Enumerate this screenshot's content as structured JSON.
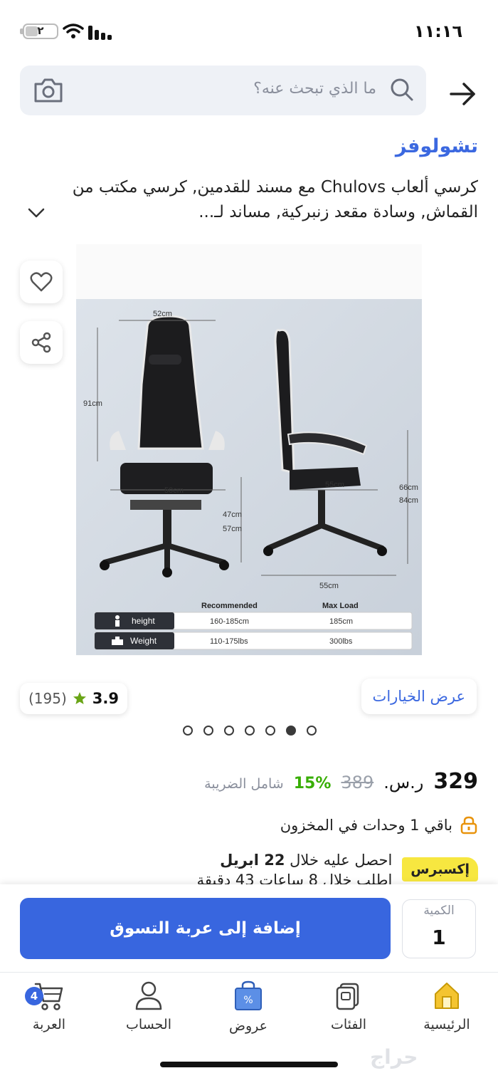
{
  "status_bar": {
    "time": "١١:١٦",
    "battery_level": "٢",
    "battery_percent": 0.4
  },
  "search": {
    "placeholder": "ما الذي تبحث عنه؟"
  },
  "product": {
    "brand": "تشولوفز",
    "title": "كرسي ألعاب Chulovs مع مسند للقدمين, كرسي مكتب من القماش, وسادة مقعد زنبركية, مساند لـ...",
    "image_text": {
      "width_label": "52cm",
      "height_label": "91cm",
      "seat_width_label": "50cm",
      "seat_height_top": "47cm",
      "seat_height_bottom": "57cm",
      "side_depth_label": "55cm",
      "total_height_top": "66cm",
      "total_height_bottom": "84cm",
      "base_label": "55cm",
      "table_header_recommended": "Recommended",
      "table_header_max": "Max Load",
      "row1_label": "height",
      "row1_recommended": "160-185cm",
      "row1_max": "185cm",
      "row2_label": "Weight",
      "row2_recommended": "110-175lbs",
      "row2_max": "300lbs"
    },
    "options_label": "عرض الخيارات",
    "rating": {
      "value": "3.9",
      "count": "(195)"
    },
    "gallery": {
      "total": 7,
      "active_index": 5
    }
  },
  "pricing": {
    "price": "329",
    "currency": "ر.س.",
    "old_price": "389",
    "discount": "15%",
    "vat_note": "شامل الضريبة"
  },
  "stock": {
    "text": "باقي 1 وحدات في المخزون"
  },
  "delivery": {
    "badge": "إكسبرس",
    "line1_prefix": "احصل عليه خلال",
    "line1_date": "22 ابريل",
    "line2": "اطلب خلال 8 ساعات 43 دقيقة"
  },
  "cart_panel": {
    "add_to_cart": "إضافة إلى عربة التسوق",
    "quantity_label": "الكمية",
    "quantity_value": "1"
  },
  "tab_bar": {
    "home": "الرئيسية",
    "categories": "الفئات",
    "offers": "عروض",
    "account": "الحساب",
    "cart": "العربة",
    "cart_count": "4"
  },
  "watermark": "حراج",
  "colors": {
    "accent": "#3866df",
    "brand": "#3b68e0",
    "discount": "#38ae04",
    "express": "#f7e740",
    "home_icon": "#f4c430"
  }
}
